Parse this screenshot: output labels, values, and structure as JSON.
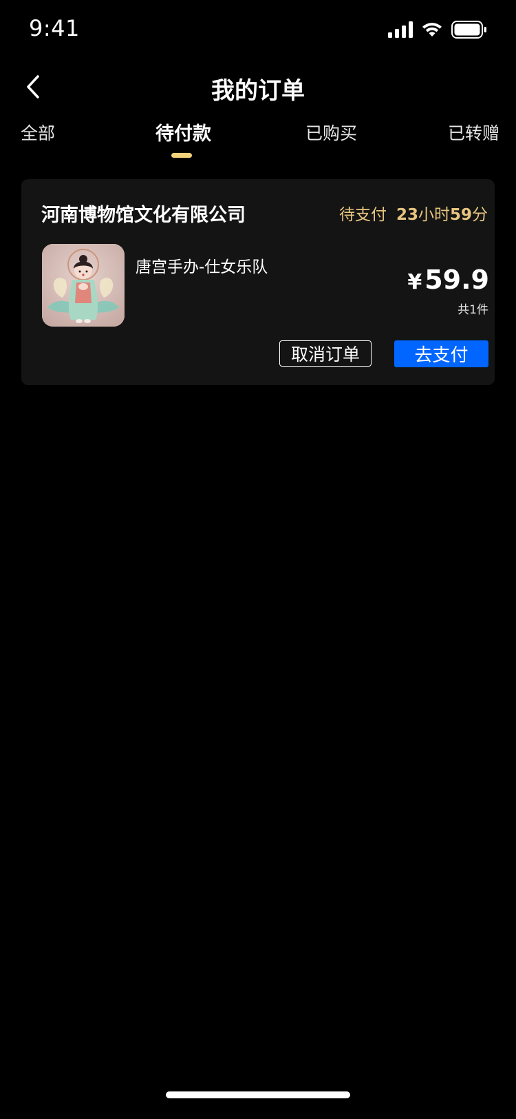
{
  "status_bar": {
    "time": "9:41",
    "icons": [
      "signal-icon",
      "wifi-icon",
      "battery-icon"
    ]
  },
  "nav": {
    "back_icon": "chevron-left-icon",
    "title": "我的订单"
  },
  "tabs": [
    {
      "label": "全部",
      "active": false
    },
    {
      "label": "待付款",
      "active": true
    },
    {
      "label": "已购买",
      "active": false
    },
    {
      "label": "已转赠",
      "active": false
    }
  ],
  "colors": {
    "background": "#000000",
    "card": "#141414",
    "accent_gold": "#e7c580",
    "tab_indicator": "#f3d27c",
    "primary_button": "#0066ff"
  },
  "order": {
    "shop_name": "河南博物馆文化有限公司",
    "status_label": "待支付",
    "countdown": {
      "hours": "23",
      "hours_unit": "小时",
      "minutes": "59",
      "minutes_unit": "分"
    },
    "product_name": "唐宫手办-仕女乐队",
    "currency": "¥",
    "price": "59.9",
    "item_count": "共1件",
    "cancel_label": "取消订单",
    "pay_label": "去支付"
  }
}
